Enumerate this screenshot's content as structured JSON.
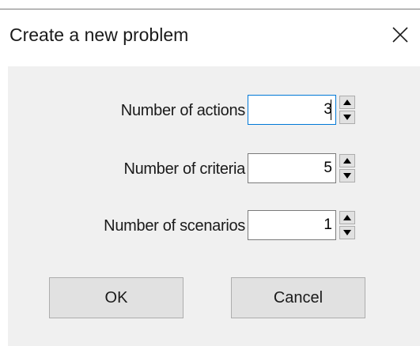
{
  "window": {
    "title": "Create a new problem"
  },
  "fields": [
    {
      "label": "Number of actions",
      "value": "3"
    },
    {
      "label": "Number of criteria",
      "value": "5"
    },
    {
      "label": "Number of scenarios",
      "value": "1"
    }
  ],
  "buttons": {
    "ok_label": "OK",
    "cancel_label": "Cancel"
  },
  "icons": {
    "close": "close-icon",
    "up": "spin-up-arrow-icon",
    "down": "spin-down-arrow-icon"
  },
  "colors": {
    "focus_border": "#0078d7",
    "dialog_background": "#f0f0f0",
    "button_face": "#e1e1e1"
  }
}
